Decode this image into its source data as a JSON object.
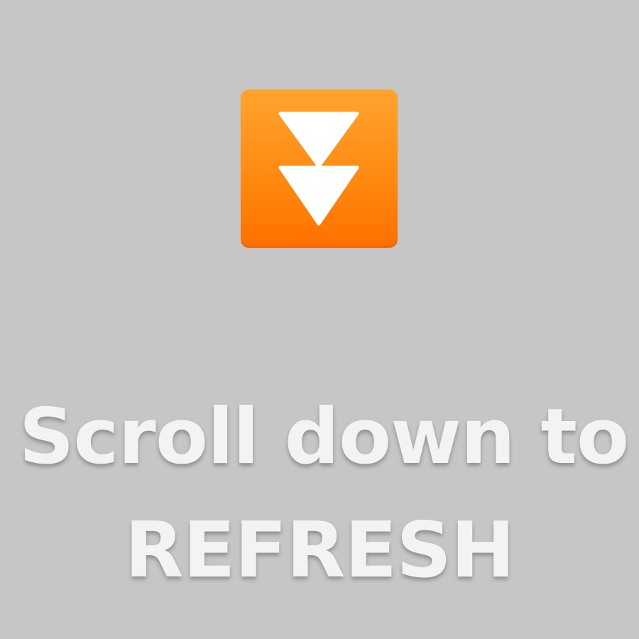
{
  "icon": {
    "name": "fast-down-button-icon",
    "tile_color_top": "#ffa42e",
    "tile_color_bottom": "#ff7000",
    "arrow_color": "#ffffff"
  },
  "message": {
    "line1": "Scroll down to",
    "line2": "REFRESH"
  },
  "background_color": "#c6c6c6"
}
